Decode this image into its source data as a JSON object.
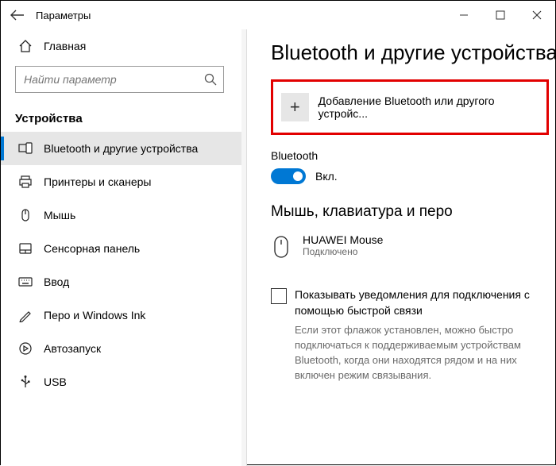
{
  "window": {
    "title": "Параметры"
  },
  "sidebar": {
    "home": "Главная",
    "search_placeholder": "Найти параметр",
    "section": "Устройства",
    "items": [
      {
        "label": "Bluetooth и другие устройства"
      },
      {
        "label": "Принтеры и сканеры"
      },
      {
        "label": "Мышь"
      },
      {
        "label": "Сенсорная панель"
      },
      {
        "label": "Ввод"
      },
      {
        "label": "Перо и Windows Ink"
      },
      {
        "label": "Автозапуск"
      },
      {
        "label": "USB"
      }
    ]
  },
  "main": {
    "title": "Bluetooth и другие устройства",
    "add_device": "Добавление Bluetooth или другого устройс...",
    "bluetooth_label": "Bluetooth",
    "bluetooth_state": "Вкл.",
    "mouse_section": "Мышь, клавиатура и перо",
    "device": {
      "name": "HUAWEI  Mouse",
      "status": "Подключено"
    },
    "checkbox": {
      "label": "Показывать уведомления для подключения с помощью быстрой связи",
      "desc": "Если этот флажок установлен, можно быстро подключаться к поддерживаемым устройствам Bluetooth, когда они находятся рядом и на них включен режим связывания."
    }
  }
}
